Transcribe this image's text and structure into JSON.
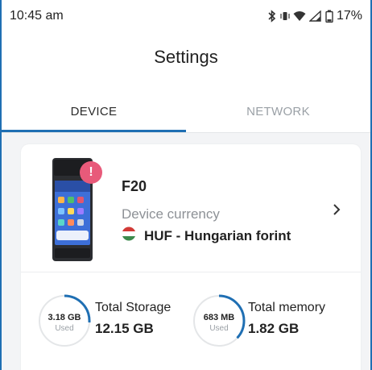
{
  "status_bar": {
    "time": "10:45 am",
    "battery": "17%",
    "icons": [
      "bluetooth-icon",
      "vibrate-icon",
      "wifi-icon",
      "signal-icon",
      "battery-icon"
    ]
  },
  "header": {
    "title": "Settings"
  },
  "tabs": [
    {
      "label": "DEVICE",
      "active": true
    },
    {
      "label": "NETWORK",
      "active": false
    }
  ],
  "device": {
    "name": "F20",
    "alert_badge": "!",
    "currency_label": "Device currency",
    "currency_value": "HUF - Hungarian forint",
    "currency_flag": "hungary-flag-icon"
  },
  "storage": {
    "used_value": "3.18 GB",
    "used_label": "Used",
    "title": "Total Storage",
    "total": "12.15 GB",
    "used_fraction": 0.26
  },
  "memory": {
    "used_value": "683 MB",
    "used_label": "Used",
    "title": "Total memory",
    "total": "1.82 GB",
    "used_fraction": 0.37
  },
  "colors": {
    "accent": "#1f6fb3",
    "alert": "#e85a7a",
    "background": "#f3f4f6"
  }
}
